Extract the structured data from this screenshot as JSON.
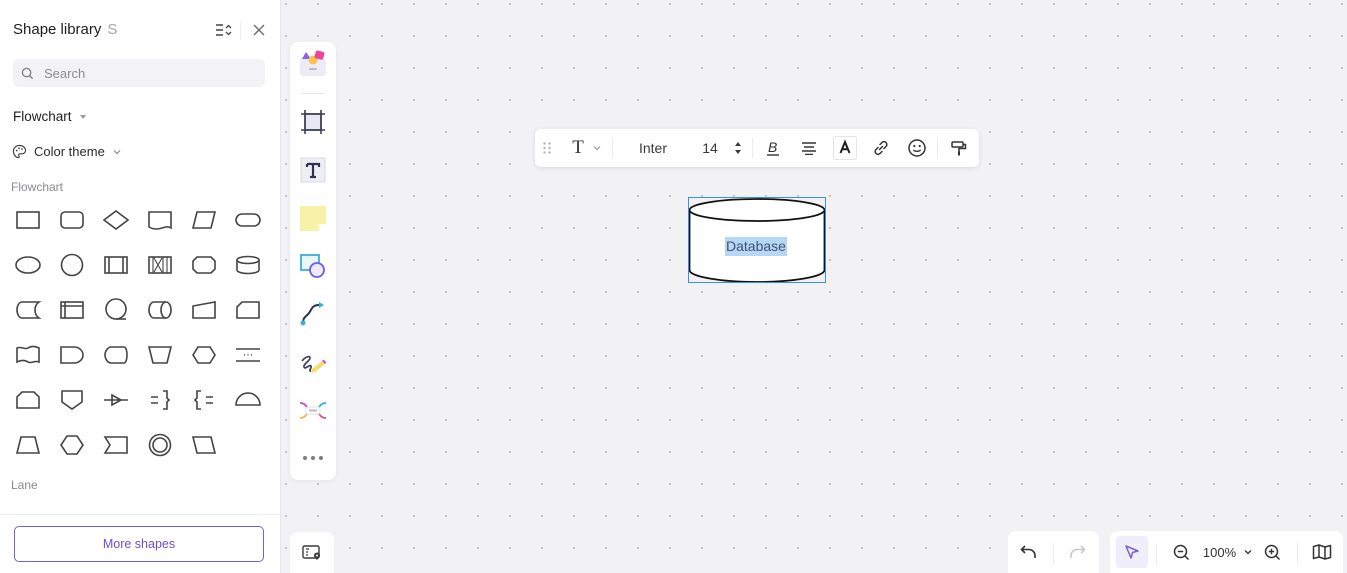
{
  "panel": {
    "title": "Shape library",
    "shortcut": "S",
    "search_placeholder": "Search",
    "search_value": "",
    "category_select": "Flowchart",
    "color_theme_label": "Color theme",
    "sections": [
      {
        "label": "Flowchart",
        "shapes": [
          "rectangle",
          "rounded-rectangle",
          "diamond",
          "document",
          "parallelogram",
          "terminator",
          "ellipse",
          "circle",
          "predefined-process",
          "predefined-process-x",
          "octagon-rect",
          "database",
          "stored-data",
          "internal-storage",
          "sequential-data",
          "direct-data",
          "manual-input",
          "card",
          "punched-tape",
          "delay",
          "display",
          "manual-operation",
          "hexagon",
          "loop-limit-dots",
          "loop-limit",
          "off-page-reference",
          "merge-arrow",
          "annotation-right",
          "annotation-left",
          "semicircle",
          "trapezoid",
          "hexagon-2",
          "pentagon-arrow",
          "double-circle",
          "parallelogram-2"
        ]
      },
      {
        "label": "Lane",
        "shapes": []
      }
    ],
    "more_shapes_label": "More shapes"
  },
  "rail": {
    "tools": [
      "templates",
      "frame",
      "text",
      "sticky-note",
      "shapes",
      "connector",
      "pen",
      "mind-map",
      "more"
    ]
  },
  "text_toolbar": {
    "text_style": "T",
    "font": "Inter",
    "font_size": "14"
  },
  "canvas": {
    "shape": {
      "type": "database",
      "label": "Database",
      "selected": true
    }
  },
  "bottom": {
    "zoom_level": "100%"
  },
  "colors": {
    "accent": "#7c5fd4",
    "selection": "#3a8fe8",
    "text_highlight": "#b7d5f7"
  }
}
